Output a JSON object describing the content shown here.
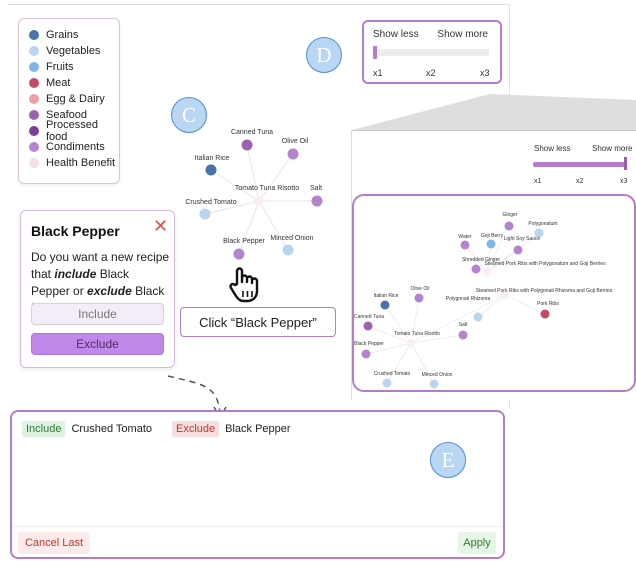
{
  "legend": {
    "items": [
      {
        "label": "Grains",
        "color": "#4a74a8"
      },
      {
        "label": "Vegetables",
        "color": "#b9d4f0"
      },
      {
        "label": "Fruits",
        "color": "#7fb6e6"
      },
      {
        "label": "Meat",
        "color": "#c74a64"
      },
      {
        "label": "Egg & Dairy",
        "color": "#eea0a8"
      },
      {
        "label": "Seafood",
        "color": "#9e63b0"
      },
      {
        "label": "Processed food",
        "color": "#7a3f93"
      },
      {
        "label": "Condiments",
        "color": "#b584cf"
      },
      {
        "label": "Health Benefit",
        "color": "#f3dfe4"
      }
    ]
  },
  "labels": {
    "c": "C",
    "d": "D",
    "e": "E"
  },
  "slider": {
    "less": "Show less",
    "more": "Show more",
    "ticks": [
      "x1",
      "x2",
      "x3"
    ],
    "value": "x1"
  },
  "zoom_slider": {
    "less": "Show less",
    "more": "Show more",
    "ticks": [
      "x1",
      "x2",
      "x3"
    ],
    "value": "x3"
  },
  "graph_main": {
    "center": "Tomato Tuna Risotto",
    "nodes": [
      {
        "label": "Canned Tuna",
        "color": "#9e63b0"
      },
      {
        "label": "Olive Oil",
        "color": "#b584cf"
      },
      {
        "label": "Italian Rice",
        "color": "#4a74a8"
      },
      {
        "label": "Salt",
        "color": "#b584cf"
      },
      {
        "label": "Crushed Tomato",
        "color": "#b9d4f0"
      },
      {
        "label": "Black Pepper",
        "color": "#b584cf"
      },
      {
        "label": "Minced Onion",
        "color": "#b9d4f0"
      }
    ]
  },
  "graph_zoom": {
    "centers": [
      "Tomato Tuna Risotto",
      "Steamed Pork Ribs with Polygonatum and Goji Berries",
      "Steamed Pork Ribs with Polygonati Rhizoma and Goji Berries"
    ],
    "nodes": [
      {
        "label": "Ginger",
        "color": "#b584cf"
      },
      {
        "label": "Polygonatum",
        "color": "#b9d4f0"
      },
      {
        "label": "Water",
        "color": "#b584cf"
      },
      {
        "label": "Goji Berry",
        "color": "#7fb6e6"
      },
      {
        "label": "Light Soy Sauce",
        "color": "#b584cf"
      },
      {
        "label": "Shredded Ginger",
        "color": "#b584cf"
      },
      {
        "label": "Italian Rice",
        "color": "#4a74a8"
      },
      {
        "label": "Olive Oil",
        "color": "#b584cf"
      },
      {
        "label": "Polygonati Rhizoma",
        "color": "#b9d4f0"
      },
      {
        "label": "Pork Ribs",
        "color": "#c74a64"
      },
      {
        "label": "Canned Tuna",
        "color": "#9e63b0"
      },
      {
        "label": "Salt",
        "color": "#b584cf"
      },
      {
        "label": "Black Pepper",
        "color": "#b584cf"
      },
      {
        "label": "Crushed Tomato",
        "color": "#b9d4f0"
      },
      {
        "label": "Minced Onion",
        "color": "#b9d4f0"
      }
    ]
  },
  "popup": {
    "title": "Black Pepper",
    "body_1": "Do you want a new recipe that ",
    "include_word": "include",
    "body_2": " Black Pepper or ",
    "exclude_word": "exclude",
    "body_3": " Black Pepper",
    "include_label": "Include",
    "exclude_label": "Exclude"
  },
  "annotation": "Click “Black Pepper”",
  "bottom": {
    "tags": [
      {
        "kind": "Include",
        "value": "Crushed Tomato"
      },
      {
        "kind": "Exclude",
        "value": "Black Pepper"
      }
    ],
    "cancel_label": "Cancel Last",
    "apply_label": "Apply"
  }
}
